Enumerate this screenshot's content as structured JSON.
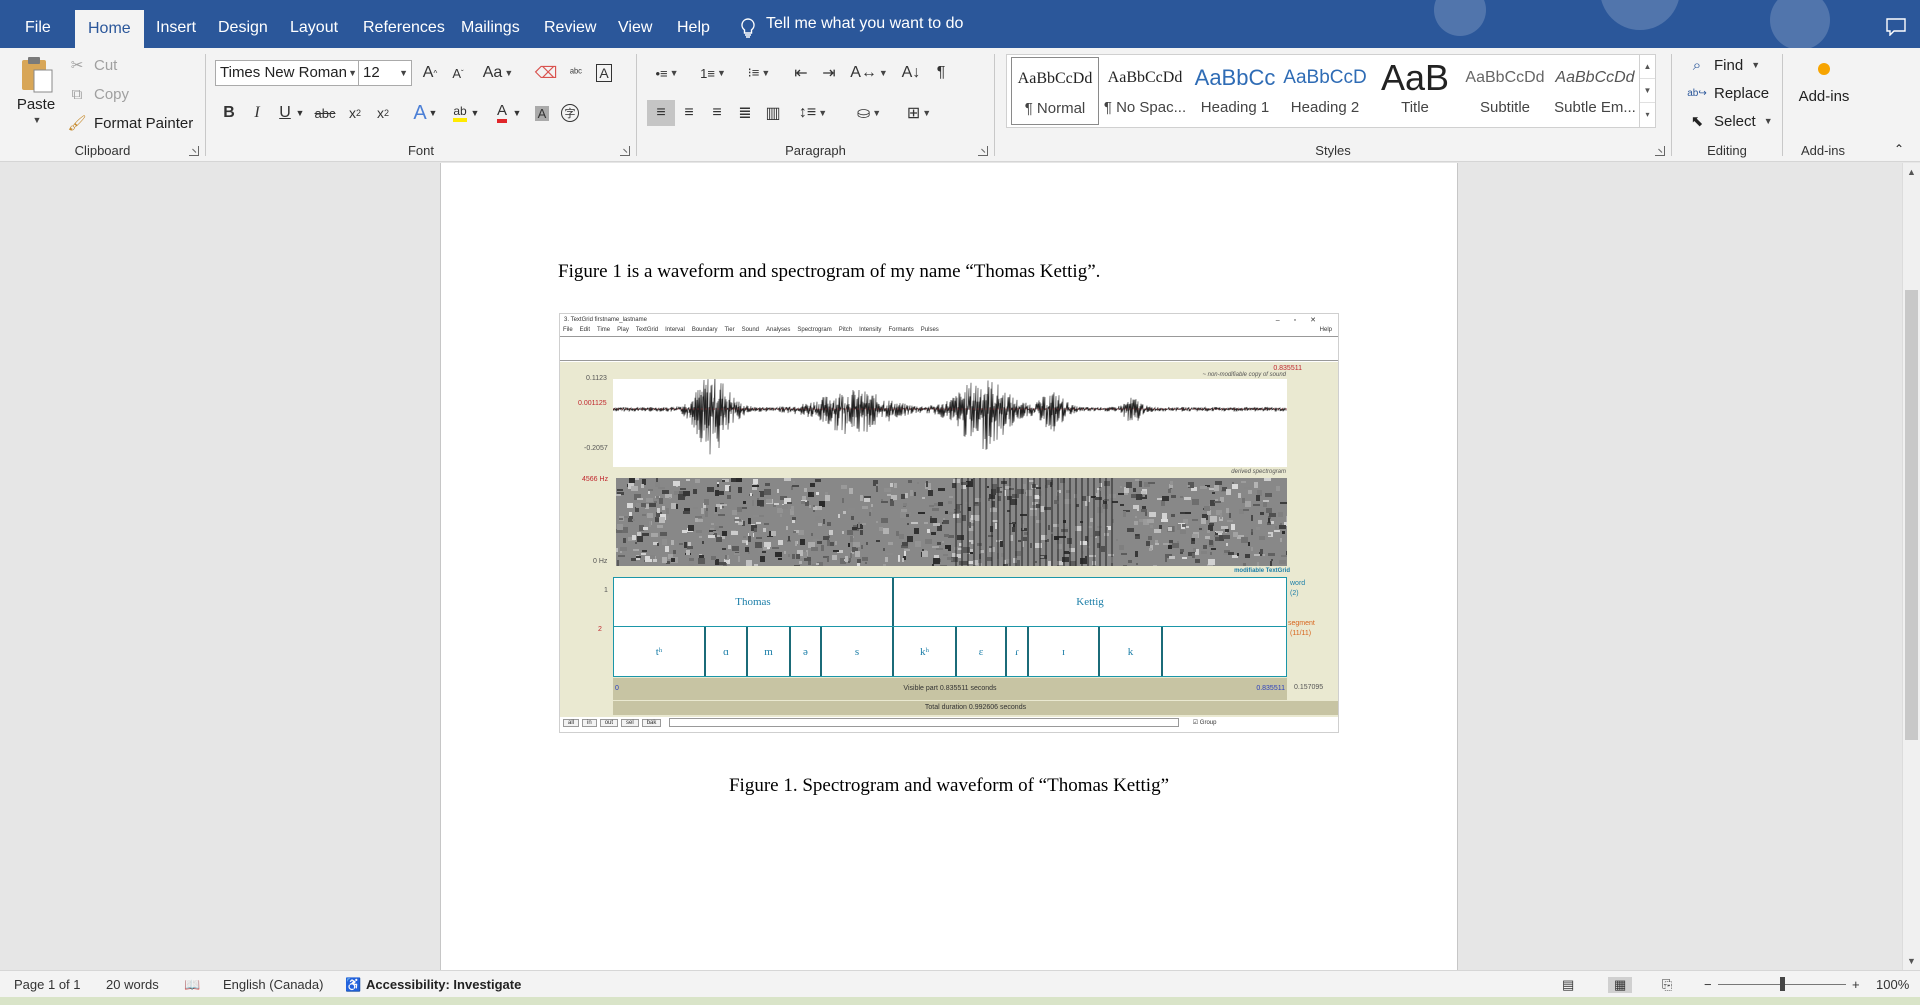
{
  "tabs": [
    {
      "label": "File",
      "active": false
    },
    {
      "label": "Home",
      "active": true
    },
    {
      "label": "Insert",
      "active": false
    },
    {
      "label": "Design",
      "active": false
    },
    {
      "label": "Layout",
      "active": false
    },
    {
      "label": "References",
      "active": false
    },
    {
      "label": "Mailings",
      "active": false
    },
    {
      "label": "Review",
      "active": false
    },
    {
      "label": "View",
      "active": false
    },
    {
      "label": "Help",
      "active": false
    }
  ],
  "tell_me": "Tell me what you want to do",
  "clipboard": {
    "paste": "Paste",
    "cut": "Cut",
    "copy": "Copy",
    "format_painter": "Format Painter",
    "label": "Clipboard"
  },
  "font": {
    "name": "Times New Roman",
    "size": "12",
    "label": "Font",
    "change_case": "Aa"
  },
  "paragraph": {
    "label": "Paragraph"
  },
  "styles": {
    "label": "Styles",
    "items": [
      {
        "preview": "AaBbCcDd",
        "name": "¶ Normal"
      },
      {
        "preview": "AaBbCcDd",
        "name": "¶ No Spac..."
      },
      {
        "preview": "AaBbCc",
        "name": "Heading 1"
      },
      {
        "preview": "AaBbCcD",
        "name": "Heading 2"
      },
      {
        "preview": "AaB",
        "name": "Title"
      },
      {
        "preview": "AaBbCcDd",
        "name": "Subtitle"
      },
      {
        "preview": "AaBbCcDd",
        "name": "Subtle Em..."
      }
    ]
  },
  "editing": {
    "find": "Find",
    "replace": "Replace",
    "select": "Select",
    "label": "Editing"
  },
  "addins": {
    "button": "Add-ins",
    "label": "Add-ins"
  },
  "document": {
    "paragraph": "Figure 1 is a waveform and spectrogram of my name “Thomas Kettig”.",
    "caption": "Figure 1. Spectrogram and waveform of “Thomas Kettig”"
  },
  "figure": {
    "window_title": "3. TextGrid firstname_lastname",
    "menu": [
      "File",
      "Edit",
      "Time",
      "Play",
      "TextGrid",
      "Interval",
      "Boundary",
      "Tier",
      "Sound",
      "Analyses",
      "Spectrogram",
      "Pitch",
      "Intensity",
      "Formants",
      "Pulses"
    ],
    "help": "Help",
    "cursor_time": "0.835511",
    "wave_max": "0.1123",
    "wave_cursor": "0.001125",
    "wave_min": "-0.2057",
    "sound_note": "~ non-modifiable copy of sound",
    "spec_note": "derived spectrogram",
    "spec_top": "4566 Hz",
    "spec_bottom": "0 Hz",
    "tg_note": "modifiable TextGrid",
    "tier1_num": "1",
    "tier2_num": "2",
    "tier1_name": "word",
    "tier1_count": "(2)",
    "tier2_name": "segment",
    "tier2_count": "(11/11)",
    "words": [
      "Thomas",
      "Kettig"
    ],
    "segments": [
      "tʰ",
      "ɑ",
      "m",
      "ə",
      "s",
      "kʰ",
      "ɛ",
      "ɾ",
      "ɪ",
      "k"
    ],
    "visible_start": "0",
    "visible_part": "Visible part 0.835511 seconds",
    "visible_end": "0.835511",
    "right_time": "0.157095",
    "total_duration": "Total duration 0.992606 seconds",
    "buttons": [
      "all",
      "in",
      "out",
      "sel",
      "bak"
    ],
    "group": "Group"
  },
  "status": {
    "page": "Page 1 of 1",
    "words": "20 words",
    "language": "English (Canada)",
    "accessibility": "Accessibility: Investigate",
    "zoom": "100%"
  },
  "colors": {
    "brand": "#2b579a",
    "textgrid": "#1b96a8"
  }
}
